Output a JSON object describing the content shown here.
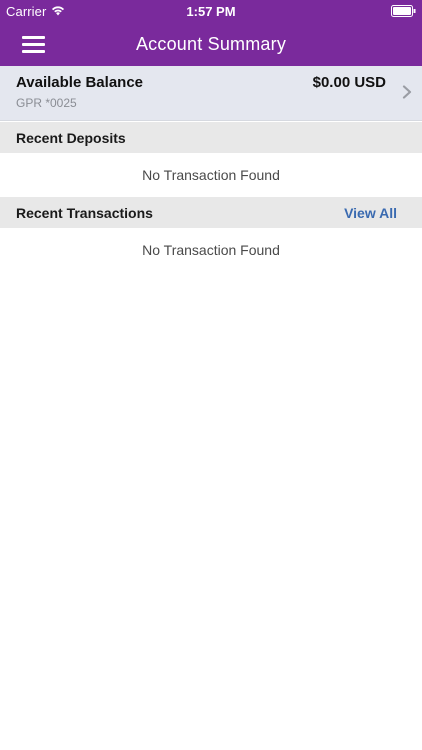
{
  "status_bar": {
    "carrier": "Carrier",
    "time": "1:57 PM",
    "wifi_icon": "wifi-icon",
    "battery_icon": "battery-icon"
  },
  "nav": {
    "title": "Account Summary",
    "menu_icon": "hamburger-menu-icon"
  },
  "balance": {
    "label": "Available Balance",
    "account": "GPR *0025",
    "amount": "$0.00 USD",
    "chevron_icon": "chevron-right-icon"
  },
  "deposits": {
    "title": "Recent Deposits",
    "empty_text": "No Transaction Found"
  },
  "transactions": {
    "title": "Recent Transactions",
    "action_label": "View All",
    "empty_text": "No Transaction Found"
  },
  "colors": {
    "header_purple": "#7a2a9c",
    "balance_bg": "#e4e7ef",
    "section_bg": "#e8e8e8",
    "link_blue": "#3a6ab0"
  }
}
